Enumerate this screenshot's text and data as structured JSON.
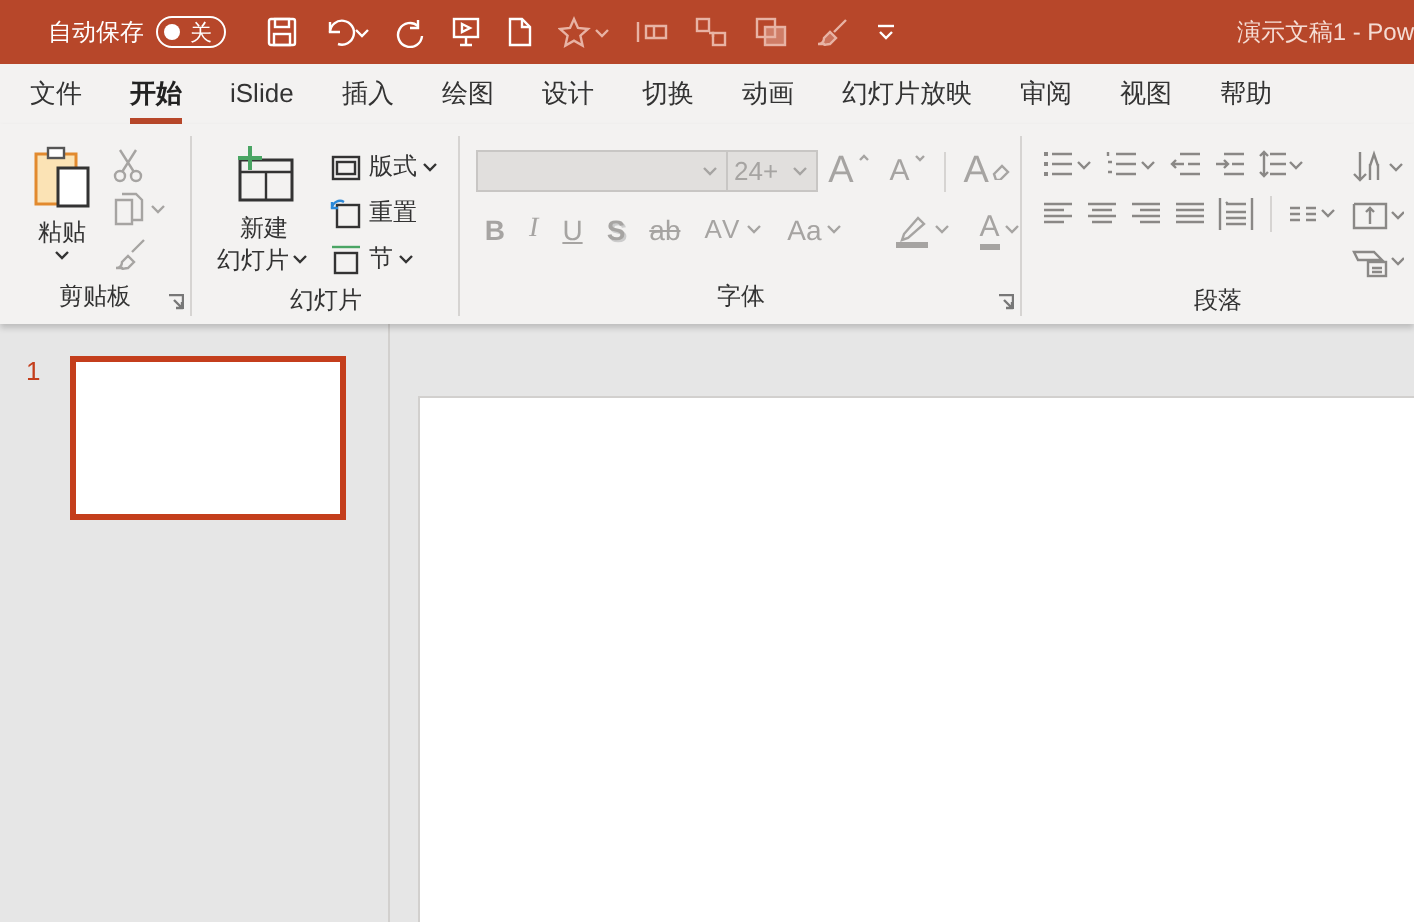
{
  "title_bar": {
    "autosave_label": "自动保存",
    "autosave_toggle": {
      "label": "关",
      "on": false
    },
    "document_title": "演示文稿1  -  Pow"
  },
  "tabs": [
    {
      "label": "文件",
      "selected": false
    },
    {
      "label": "开始",
      "selected": true
    },
    {
      "label": "iSlide",
      "selected": false
    },
    {
      "label": "插入",
      "selected": false
    },
    {
      "label": "绘图",
      "selected": false
    },
    {
      "label": "设计",
      "selected": false
    },
    {
      "label": "切换",
      "selected": false
    },
    {
      "label": "动画",
      "selected": false
    },
    {
      "label": "幻灯片放映",
      "selected": false
    },
    {
      "label": "审阅",
      "selected": false
    },
    {
      "label": "视图",
      "selected": false
    },
    {
      "label": "帮助",
      "selected": false
    }
  ],
  "ribbon": {
    "clipboard": {
      "label": "剪贴板",
      "paste": "粘贴",
      "tools": [
        {
          "kind": "cut",
          "disabled": true
        },
        {
          "kind": "copy",
          "disabled": true
        },
        {
          "kind": "painter",
          "disabled": true
        }
      ]
    },
    "slides": {
      "label": "幻灯片",
      "new_slide": [
        "新建",
        "幻灯片"
      ],
      "layout": "版式",
      "reset": "重置",
      "section": "节"
    },
    "font": {
      "label": "字体",
      "disabled": true,
      "font_size": "24+",
      "size_buttons": [
        {
          "label": "A",
          "kind": "grow"
        },
        {
          "label": "A",
          "kind": "shrink"
        }
      ],
      "clear_format": "A",
      "buttons": [
        {
          "label": "B",
          "kind": "bold"
        },
        {
          "label": "I",
          "kind": "italic"
        },
        {
          "label": "U",
          "kind": "underline"
        },
        {
          "label": "S",
          "kind": "shadow"
        },
        {
          "label": "ab",
          "kind": "strike"
        },
        {
          "label": "AV",
          "kind": "spacing"
        },
        {
          "label": "Aa",
          "kind": "case"
        }
      ],
      "font_color": "A"
    },
    "paragraph": {
      "label": "段落",
      "disabled": true
    }
  },
  "thumbnails": [
    {
      "number": "1",
      "selected": true
    }
  ]
}
